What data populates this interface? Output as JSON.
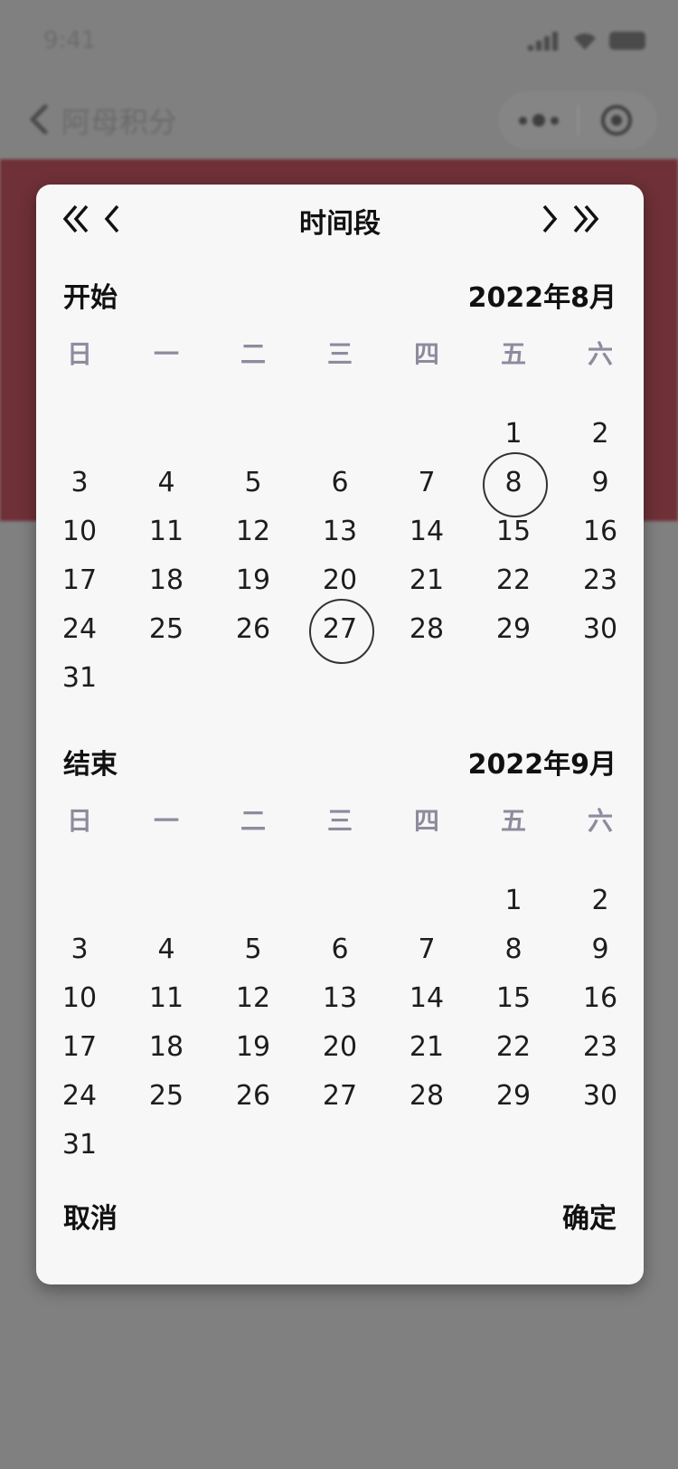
{
  "status_bar": {
    "time": "9:41"
  },
  "nav": {
    "title": "阿母积分"
  },
  "modal": {
    "title": "时间段",
    "weekdays": [
      "日",
      "一",
      "二",
      "三",
      "四",
      "五",
      "六"
    ],
    "start": {
      "label": "开始",
      "month_label": "2022年8月",
      "first_weekday": 5,
      "days_in_month": 31,
      "selected_days": [
        8,
        27
      ]
    },
    "end": {
      "label": "结束",
      "month_label": "2022年9月",
      "first_weekday": 5,
      "days_in_month": 31,
      "selected_days": []
    },
    "cancel_label": "取消",
    "confirm_label": "确定"
  },
  "colors": {
    "overlay": "#7f7f7f",
    "hero_band": "#6f3037",
    "modal_bg": "#f7f7f7",
    "weekday_text": "#8e8b9e",
    "day_text": "#1d1d1d"
  },
  "icons": {
    "prev_year": "double-chevron-left-icon",
    "prev_month": "chevron-left-icon",
    "next_month": "chevron-right-icon",
    "next_year": "double-chevron-right-icon"
  }
}
